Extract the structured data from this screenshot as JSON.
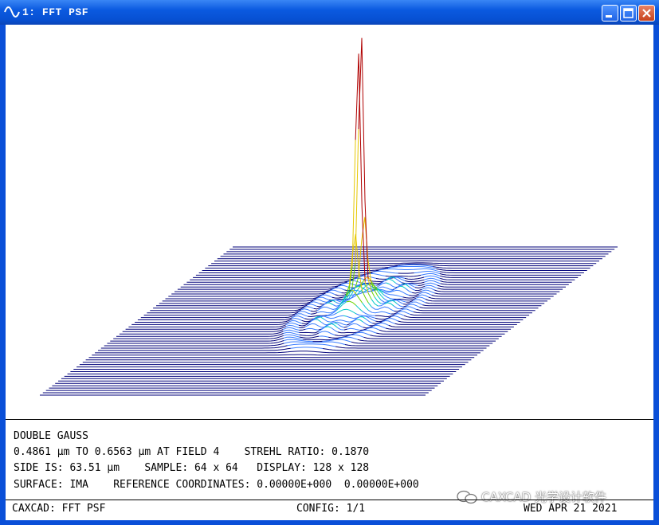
{
  "window": {
    "title": "1: FFT PSF",
    "controls": [
      "minimize-icon",
      "maximize-icon",
      "close-icon"
    ]
  },
  "plot": {
    "description_colors": {
      "grid": "#00007a",
      "peak": "#b00000",
      "ring": "#00c8ff"
    }
  },
  "info": {
    "line1": "DOUBLE GAUSS",
    "line2": "0.4861 µm TO 0.6563 µm AT FIELD 4    STREHL RATIO: 0.1870",
    "line3": "SIDE IS: 63.51 µm    SAMPLE: 64 x 64   DISPLAY: 128 x 128",
    "line4": "SURFACE: IMA    REFERENCE COORDINATES: 0.00000E+000  0.00000E+000"
  },
  "footer": {
    "left": "CAXCAD: FFT PSF",
    "center": "CONFIG: 1/1",
    "right": "WED APR 21 2021"
  },
  "watermark": {
    "text": "CAXCAD 光学设计软件",
    "icon": "wechat-icon"
  }
}
